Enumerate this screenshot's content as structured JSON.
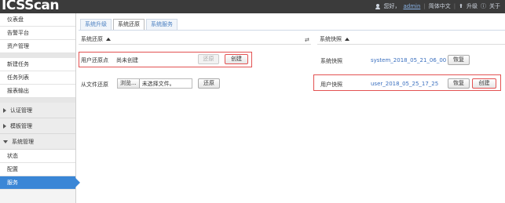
{
  "header": {
    "logo": "ICSScan",
    "greeting": "您好，",
    "username": "admin",
    "language": "简体中文",
    "upgrade": "升级",
    "about": "关于"
  },
  "sidebar": {
    "group1": [
      "仪表盘",
      "告警平台",
      "资产管理"
    ],
    "group2": [
      "新建任务",
      "任务列表",
      "报表输出"
    ],
    "sections": {
      "auth": "认证管理",
      "template": "模板管理",
      "system": "系统管理"
    },
    "system_items": [
      "状态",
      "配置",
      "服务"
    ]
  },
  "tabs": [
    "系统升级",
    "系统还原",
    "系统服务"
  ],
  "restore": {
    "title": "系统还原",
    "user_restore_label": "用户还原点",
    "user_restore_value": "尚未创建",
    "restore_btn": "还原",
    "create_btn": "创建",
    "file_restore_label": "从文件还原",
    "browse_btn": "浏览...",
    "no_file": "未选择文件。",
    "file_restore_btn": "还原"
  },
  "snapshot": {
    "title": "系统快照",
    "system_label": "系统快照",
    "system_value": "system_2018_05_21_06_00",
    "system_restore_btn": "恢复",
    "user_label": "用户快照",
    "user_value": "user_2018_05_25_17_25",
    "user_restore_btn": "恢复",
    "user_create_btn": "创建"
  },
  "colors": {
    "header_bg": "#3b3b3b",
    "active_nav": "#3a86d6",
    "highlight_border": "#e35252",
    "link": "#3a6fbf"
  }
}
